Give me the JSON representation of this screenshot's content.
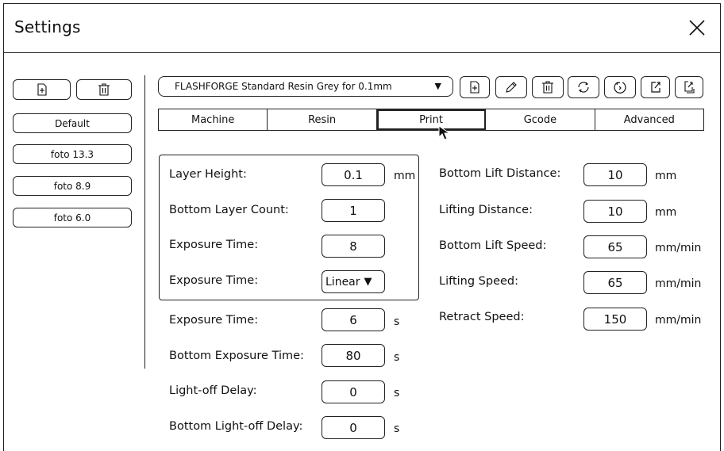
{
  "window": {
    "title": "Settings",
    "close_icon": "close-icon"
  },
  "sidebar": {
    "add_icon": "add-file-icon",
    "delete_icon": "trash-icon",
    "items": [
      {
        "label": "Default"
      },
      {
        "label": "foto 13.3"
      },
      {
        "label": "foto 8.9"
      },
      {
        "label": "foto 6.0"
      }
    ]
  },
  "profile": {
    "selected": "FLASHFORGE Standard Resin Grey for 0.1mm",
    "toolbar_icons": [
      "add-file-icon",
      "edit-pencil-icon",
      "trash-icon",
      "refresh-icon",
      "reload-icon",
      "export-icon",
      "export-all-icon"
    ]
  },
  "tabs": [
    {
      "label": "Machine"
    },
    {
      "label": "Resin"
    },
    {
      "label": "Print",
      "active": true
    },
    {
      "label": "Gcode"
    },
    {
      "label": "Advanced"
    }
  ],
  "left_fields": {
    "layer_height": {
      "label": "Layer Height:",
      "value": "0.1",
      "unit": "mm"
    },
    "bottom_layer_count": {
      "label": "Bottom Layer Count:",
      "value": "1"
    },
    "exposure_time_a": {
      "label": "Exposure Time:",
      "value": "8"
    },
    "exposure_time_mode": {
      "label": "Exposure Time:",
      "value": "Linear"
    },
    "exposure_time_b": {
      "label": "Exposure Time:",
      "value": "6",
      "unit": "s"
    },
    "bottom_exposure_time": {
      "label": "Bottom Exposure Time:",
      "value": "80",
      "unit": "s"
    },
    "light_off_delay": {
      "label": "Light-off Delay:",
      "value": "0",
      "unit": "s"
    },
    "bottom_light_off_delay": {
      "label": "Bottom Light-off Delay:",
      "value": "0",
      "unit": "s"
    }
  },
  "right_fields": {
    "bottom_lift_distance": {
      "label": "Bottom Lift Distance:",
      "value": "10",
      "unit": "mm"
    },
    "lifting_distance": {
      "label": "Lifting Distance:",
      "value": "10",
      "unit": "mm"
    },
    "bottom_lift_speed": {
      "label": "Bottom Lift Speed:",
      "value": "65",
      "unit": "mm/min"
    },
    "lifting_speed": {
      "label": "Lifting Speed:",
      "value": "65",
      "unit": "mm/min"
    },
    "retract_speed": {
      "label": "Retract Speed:",
      "value": "150",
      "unit": "mm/min"
    }
  }
}
